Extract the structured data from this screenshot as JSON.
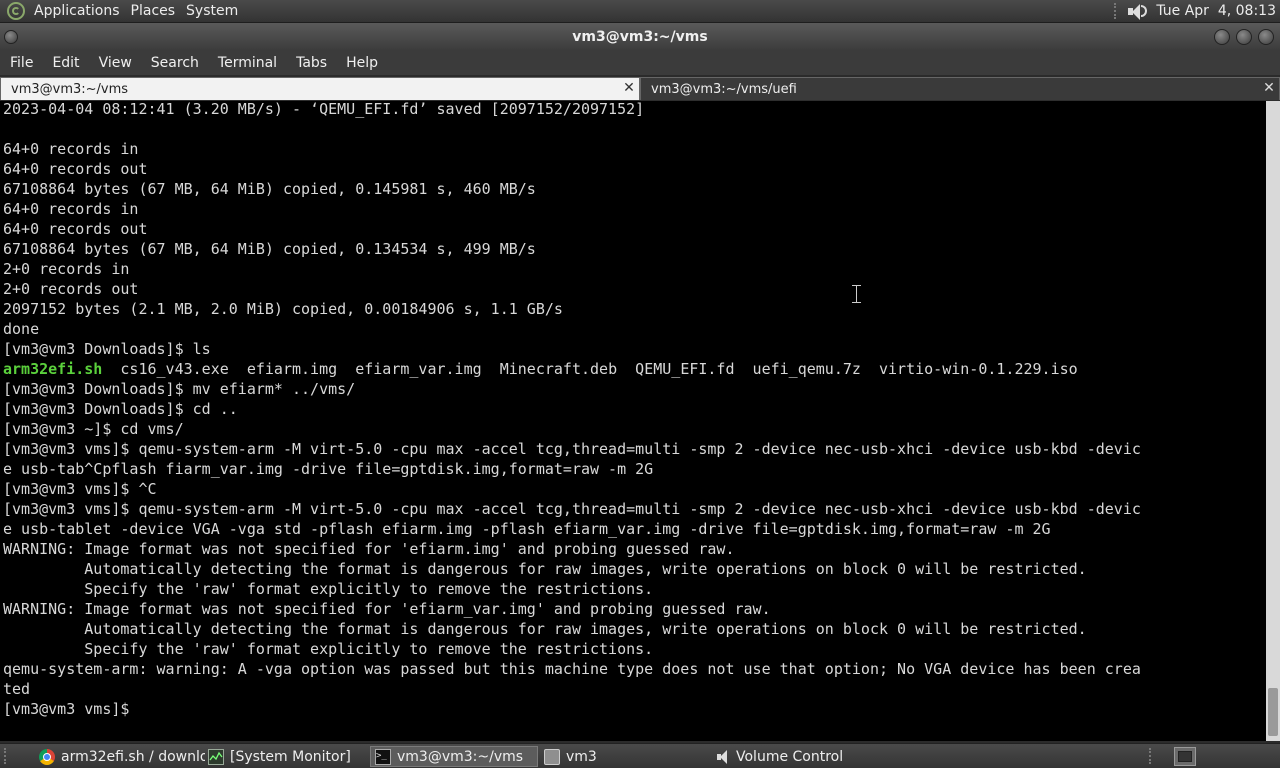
{
  "top_panel": {
    "menus": [
      "Applications",
      "Places",
      "System"
    ],
    "clock": "Tue Apr  4, 08:13"
  },
  "window": {
    "title": "vm3@vm3:~/vms"
  },
  "menubar": [
    "File",
    "Edit",
    "View",
    "Search",
    "Terminal",
    "Tabs",
    "Help"
  ],
  "tabs": [
    {
      "label": "vm3@vm3:~/vms",
      "active": true
    },
    {
      "label": "vm3@vm3:~/vms/uefi",
      "active": false
    }
  ],
  "terminal": {
    "lines": [
      "2023-04-04 08:12:41 (3.20 MB/s) - ‘QEMU_EFI.fd’ saved [2097152/2097152]",
      "",
      "64+0 records in",
      "64+0 records out",
      "67108864 bytes (67 MB, 64 MiB) copied, 0.145981 s, 460 MB/s",
      "64+0 records in",
      "64+0 records out",
      "67108864 bytes (67 MB, 64 MiB) copied, 0.134534 s, 499 MB/s",
      "2+0 records in",
      "2+0 records out",
      "2097152 bytes (2.1 MB, 2.0 MiB) copied, 0.00184906 s, 1.1 GB/s",
      "done",
      "[vm3@vm3 Downloads]$ ls",
      "",
      "[vm3@vm3 Downloads]$ mv efiarm* ../vms/",
      "[vm3@vm3 Downloads]$ cd ..",
      "[vm3@vm3 ~]$ cd vms/",
      "[vm3@vm3 vms]$ qemu-system-arm -M virt-5.0 -cpu max -accel tcg,thread=multi -smp 2 -device nec-usb-xhci -device usb-kbd -devic",
      "e usb-tab^Cpflash fiarm_var.img -drive file=gptdisk.img,format=raw -m 2G",
      "[vm3@vm3 vms]$ ^C",
      "[vm3@vm3 vms]$ qemu-system-arm -M virt-5.0 -cpu max -accel tcg,thread=multi -smp 2 -device nec-usb-xhci -device usb-kbd -devic",
      "e usb-tablet -device VGA -vga std -pflash efiarm.img -pflash efiarm_var.img -drive file=gptdisk.img,format=raw -m 2G",
      "WARNING: Image format was not specified for 'efiarm.img' and probing guessed raw.",
      "         Automatically detecting the format is dangerous for raw images, write operations on block 0 will be restricted.",
      "         Specify the 'raw' format explicitly to remove the restrictions.",
      "WARNING: Image format was not specified for 'efiarm_var.img' and probing guessed raw.",
      "         Automatically detecting the format is dangerous for raw images, write operations on block 0 will be restricted.",
      "         Specify the 'raw' format explicitly to remove the restrictions.",
      "qemu-system-arm: warning: A -vga option was passed but this machine type does not use that option; No VGA device has been crea",
      "ted",
      "[vm3@vm3 vms]$ "
    ],
    "ls_output": {
      "executable": "arm32efi.sh",
      "rest": "  cs16_v43.exe  efiarm.img  efiarm_var.img  Minecraft.deb  QEMU_EFI.fd  uefi_qemu.7z  virtio-win-0.1.229.iso"
    },
    "colors": {
      "executable": "#5bd13c",
      "text": "#d8d8d8",
      "background": "#000000"
    }
  },
  "taskbar": {
    "items": [
      {
        "label": "arm32efi.sh / downlo...",
        "icon": "chrome-icon"
      },
      {
        "label": "[System Monitor]",
        "icon": "system-monitor-icon"
      },
      {
        "label": "vm3@vm3:~/vms",
        "icon": "terminal-icon",
        "active": true
      },
      {
        "label": "vm3",
        "icon": "folder-icon"
      },
      {
        "label": "Volume Control",
        "icon": "volume-icon"
      }
    ]
  }
}
